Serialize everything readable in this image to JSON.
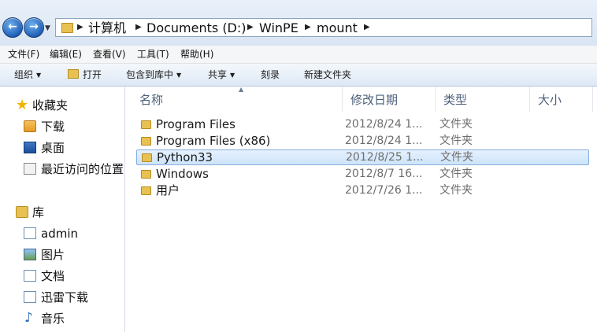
{
  "address_bar": {
    "breadcrumbs": [
      "计算机",
      "Documents (D:)",
      "WinPE",
      "mount"
    ]
  },
  "menu": [
    "文件(F)",
    "编辑(E)",
    "查看(V)",
    "工具(T)",
    "帮助(H)"
  ],
  "toolbar": {
    "organize": "组织",
    "open": "打开",
    "include_in_library": "包含到库中",
    "share": "共享",
    "burn": "刻录",
    "new_folder": "新建文件夹"
  },
  "nav": {
    "favorites": "收藏夹",
    "favorite_items": [
      "下载",
      "桌面",
      "最近访问的位置"
    ],
    "libraries": "库",
    "library_items": [
      "admin",
      "图片",
      "文档",
      "迅雷下载",
      "音乐"
    ]
  },
  "columns": [
    "名称",
    "修改日期",
    "类型",
    "大小"
  ],
  "files": [
    {
      "name": "Program Files",
      "date": "2012/8/24 1...",
      "type": "文件夹",
      "selected": false
    },
    {
      "name": "Program Files (x86)",
      "date": "2012/8/24 1...",
      "type": "文件夹",
      "selected": false
    },
    {
      "name": "Python33",
      "date": "2012/8/25 1...",
      "type": "文件夹",
      "selected": true
    },
    {
      "name": "Windows",
      "date": "2012/8/7 16...",
      "type": "文件夹",
      "selected": false
    },
    {
      "name": "用户",
      "date": "2012/7/26 1...",
      "type": "文件夹",
      "selected": false
    }
  ],
  "icons": {
    "back": "back-arrow-icon",
    "forward": "forward-arrow-icon",
    "folder": "folder-icon",
    "star": "star-icon",
    "music": "music-note-icon"
  }
}
